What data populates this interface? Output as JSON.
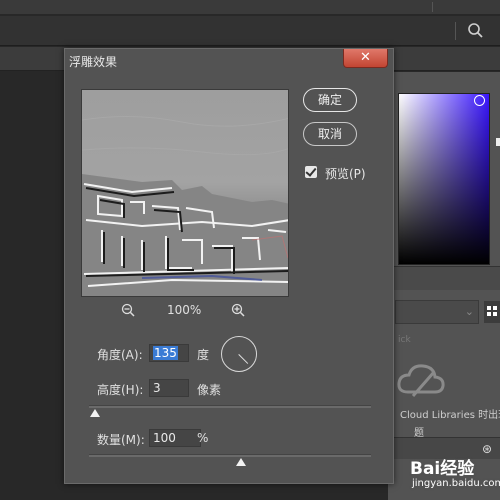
{
  "app": {
    "search_icon": "search-icon",
    "library_search_placeholder": "ick",
    "cloud_libraries_text": "Cloud Libraries 时出现问",
    "cloud_libraries_text2": "题",
    "watermark_main": "Bai经验",
    "watermark_sub": "jingyan.baidu.com",
    "color_picker_colors": [
      "#ffffff",
      "#3a16ff",
      "#000000"
    ]
  },
  "dialog": {
    "title": "浮雕效果",
    "close_label": "✕",
    "ok_label": "确定",
    "cancel_label": "取消",
    "preview_label": "预览(P)",
    "preview_checked": true,
    "zoom_value": "100%",
    "angle_label": "角度(A):",
    "angle_value": "135",
    "angle_unit": "度",
    "height_label": "高度(H):",
    "height_value": "3",
    "height_unit": "像素",
    "height_slider_fraction": 0.02,
    "amount_label": "数量(M):",
    "amount_value": "100",
    "amount_unit": "%",
    "amount_slider_fraction": 0.54
  }
}
